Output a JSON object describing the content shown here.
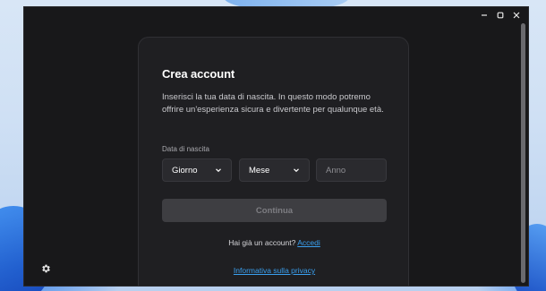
{
  "card": {
    "title": "Crea account",
    "subtitle": "Inserisci la tua data di nascita. In questo modo potremo offrire un'esperienza sicura e divertente per qualunque età.",
    "birthdate_label": "Data di nascita",
    "day_select": "Giorno",
    "month_select": "Mese",
    "year_placeholder": "Anno",
    "submit_label": "Continua",
    "login_prompt": "Hai già un account?",
    "login_link": "Accedi",
    "privacy_link": "Informativa sulla privacy"
  },
  "colors": {
    "window_bg": "#18181a",
    "card_bg": "#1f1f22",
    "link": "#3aa0f0",
    "button_disabled": "#3e3e42"
  },
  "icons": {
    "minimize": "minimize-icon",
    "maximize": "maximize-icon",
    "close": "close-icon",
    "settings": "gear-icon",
    "dropdown": "chevron-down-icon"
  }
}
